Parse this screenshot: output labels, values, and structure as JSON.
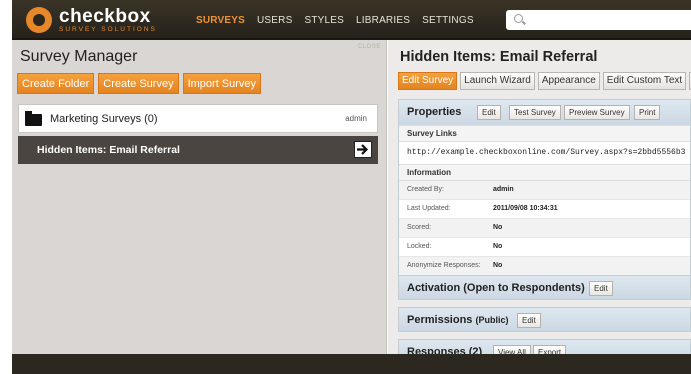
{
  "app": {
    "logo_name": "checkbox",
    "logo_tagline": "SURVEY SOLUTIONS",
    "nav": [
      "SURVEYS",
      "USERS",
      "STYLES",
      "LIBRARIES",
      "SETTINGS"
    ],
    "active_nav": "SURVEYS",
    "search_placeholder": ""
  },
  "left_panel": {
    "title": "Survey Manager",
    "close_label": "CLOSE",
    "actions": [
      "Create Folder",
      "Create Survey",
      "Import Survey"
    ],
    "folder": {
      "label": "Marketing Surveys (0)",
      "owner": "admin"
    },
    "selected_survey": "Hidden Items: Email Referral"
  },
  "right_panel": {
    "title": "Hidden Items: Email Referral",
    "toolbar": [
      "Edit Survey",
      "Launch Wizard",
      "Appearance",
      "Edit Custom Text",
      "M"
    ],
    "properties": {
      "title": "Properties",
      "buttons": [
        "Edit",
        "Test Survey",
        "Preview Survey",
        "Print"
      ],
      "links_header": "Survey Links",
      "survey_url": "http://example.checkboxonline.com/Survey.aspx?s=2bbd5556b3",
      "info_header": "Information",
      "info": [
        {
          "key": "Created By:",
          "value": "admin"
        },
        {
          "key": "Last Updated:",
          "value": "2011/09/08 10:34:31"
        },
        {
          "key": "Scored:",
          "value": "No"
        },
        {
          "key": "Locked:",
          "value": "No"
        },
        {
          "key": "Anonymize Responses:",
          "value": "No"
        }
      ]
    },
    "activation": {
      "title": "Activation (Open to Respondents)",
      "button": "Edit"
    },
    "permissions": {
      "title": "Permissions",
      "badge": "(Public)",
      "button": "Edit"
    },
    "responses": {
      "title": "Responses (2)",
      "buttons": [
        "View All",
        "Export"
      ]
    }
  },
  "colors": {
    "accent_orange": "#e8872a",
    "header_dark": "#2a261e",
    "selected_row": "#4a4540",
    "section_header": "#cbd7e2"
  }
}
